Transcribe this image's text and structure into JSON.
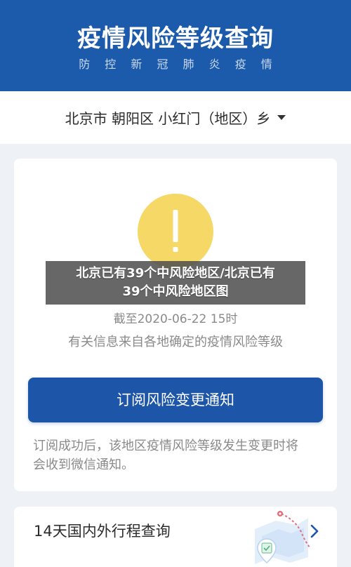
{
  "header": {
    "title": "疫情风险等级查询",
    "subtitle": "防 控 新 冠 肺 炎 疫 情"
  },
  "location": {
    "text": "北京市 朝阳区 小红门（地区）乡",
    "icon": "caret-down-icon"
  },
  "status_card": {
    "icon": "exclamation-icon",
    "updated": "截至2020-06-22 15时",
    "source_note": "有关信息来自各地确定的疫情风险等级",
    "subscribe_button": "订阅风险变更通知",
    "subscribe_note_lines": [
      "订阅成功后，该地区疫情风险等级发生变更时将",
      "会收到微信通知。"
    ]
  },
  "overlay": {
    "lines": [
      "北京已有39个中风险地区/北京已有",
      "39个中风险地区图"
    ]
  },
  "travel_card": {
    "label": "14天国内外行程查询",
    "illustration_icon": "map-pin-icon",
    "arrow_icon": "chevron-right-icon"
  },
  "colors": {
    "header_blue": "#1c5bab",
    "button_blue": "#1d56a8",
    "warning_yellow": "#f5d866",
    "page_bg": "#eef1f5"
  }
}
